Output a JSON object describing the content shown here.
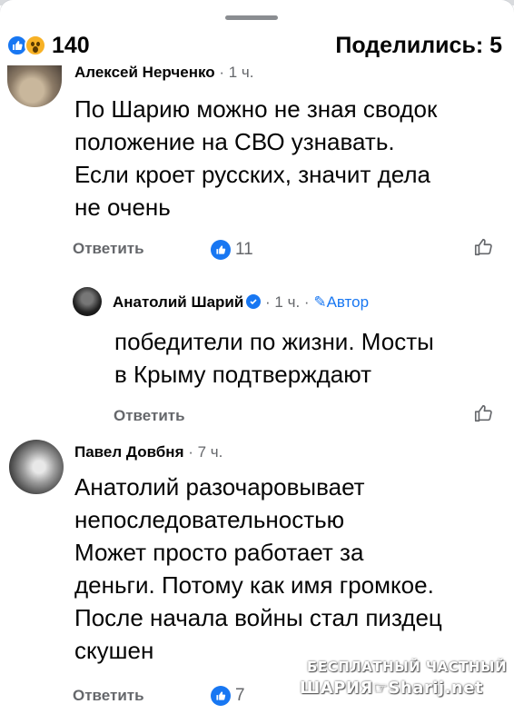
{
  "summary": {
    "reaction_count": "140",
    "shares_label": "Поделились: 5",
    "icons": [
      "like-emoji",
      "wow-emoji"
    ]
  },
  "comments": [
    {
      "author": "Алексей Нерченко",
      "time": "· 1 ч.",
      "text": "По Шарию можно не зная сводок\nположение на СВО узнавать.\nЕсли кроет русских, значит дела\nне очень",
      "reply_label": "Ответить",
      "reaction_count": "11"
    },
    {
      "author": "Анатолий Шарий",
      "time": "· 1 ч. ·",
      "author_badge": "Автор",
      "text": "победители по жизни. Мосты\nв Крыму подтверждают",
      "reply_label": "Ответить"
    },
    {
      "author": "Павел Довбня",
      "time": "· 7 ч.",
      "text": "Анатолий разочаровывает\nнепоследовательностью\nМожет просто работает за\nденьги. Потому как имя громкое.\nПосле начала войны стал пиздец\nскушен",
      "reply_label": "Ответить",
      "reaction_count": "7"
    }
  ],
  "watermark": {
    "line1": "БЕСПЛАТНЫЙ ЧАСТНЫЙ",
    "line2": "ШАРИЯ☞Sharij.net"
  },
  "colors": {
    "accent": "#1877f2",
    "muted_text": "#65676b",
    "text": "#050505"
  }
}
